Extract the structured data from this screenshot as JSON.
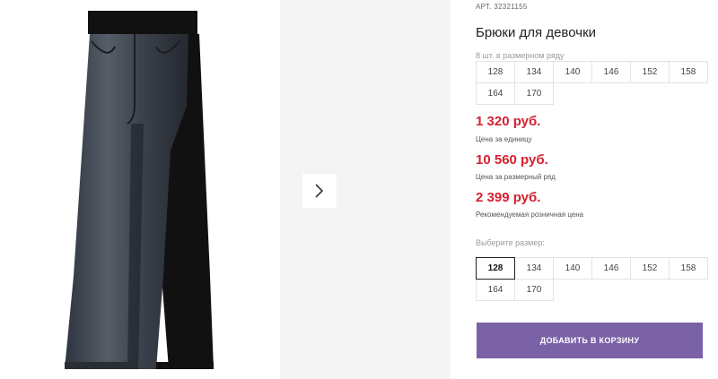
{
  "product": {
    "art_prefix": "АРТ.",
    "art_number": "32321155",
    "title": "Брюки для девочки"
  },
  "size_row": {
    "label": "8 шт. в размерном ряду",
    "sizes": [
      "128",
      "134",
      "140",
      "146",
      "152",
      "158",
      "164",
      "170"
    ]
  },
  "prices": [
    {
      "value": "1 320 руб.",
      "caption": "Цена за единицу"
    },
    {
      "value": "10 560 руб.",
      "caption": "Цена за размерный ряд"
    },
    {
      "value": "2 399 руб.",
      "caption": "Рекомендуемая розничная цена"
    }
  ],
  "size_select": {
    "label": "Выберите размер:",
    "sizes": [
      "128",
      "134",
      "140",
      "146",
      "152",
      "158",
      "164",
      "170"
    ],
    "selected": "128"
  },
  "cart_button": {
    "label": "ДОБАВИТЬ В КОРЗИНУ"
  },
  "colors": {
    "price": "#d32230",
    "accent": "#7b61a6"
  },
  "icons": {
    "next": "chevron-right-icon"
  }
}
